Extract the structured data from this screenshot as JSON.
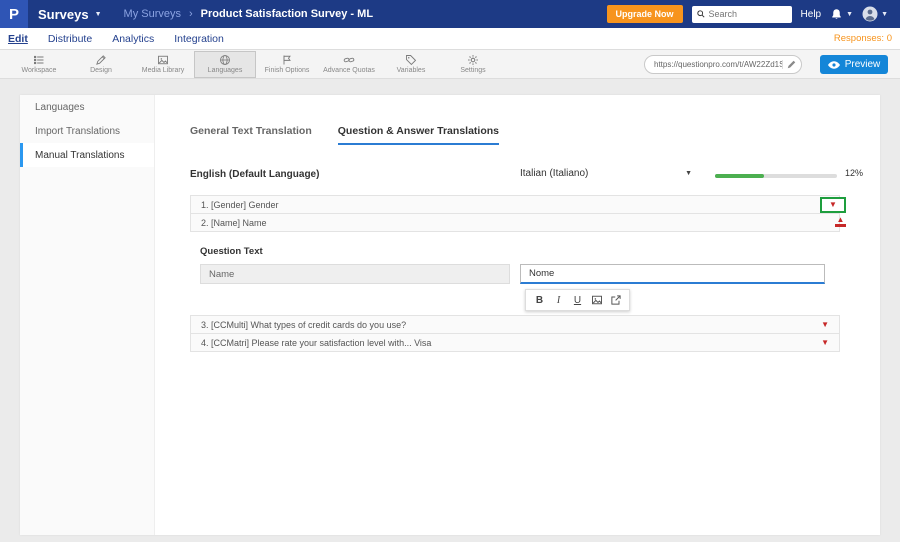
{
  "topbar": {
    "logo_letter": "P",
    "app_menu": "Surveys",
    "breadcrumb": "My Surveys",
    "separator": "›",
    "page_title": "Product Satisfaction Survey - ML",
    "upgrade_label": "Upgrade Now",
    "search_placeholder": "Search",
    "help_label": "Help"
  },
  "navbar": {
    "items": [
      {
        "label": "Edit"
      },
      {
        "label": "Distribute"
      },
      {
        "label": "Analytics"
      },
      {
        "label": "Integration"
      }
    ],
    "responses_label": "Responses: 0"
  },
  "toolbar": {
    "items": [
      {
        "label": "Workspace"
      },
      {
        "label": "Design"
      },
      {
        "label": "Media Library"
      },
      {
        "label": "Languages"
      },
      {
        "label": "Finish Options"
      },
      {
        "label": "Advance Quotas"
      },
      {
        "label": "Variables"
      },
      {
        "label": "Settings"
      }
    ],
    "survey_url": "https://questionpro.com/t/AW22Zd1S1",
    "preview_label": "Preview"
  },
  "sidebar": {
    "items": [
      {
        "label": "Languages"
      },
      {
        "label": "Import Translations"
      },
      {
        "label": "Manual Translations"
      }
    ]
  },
  "translation": {
    "tabs": [
      {
        "label": "General Text Translation"
      },
      {
        "label": "Question & Answer Translations"
      }
    ],
    "source_language": "English (Default Language)",
    "target_language": "Italian (Italiano)",
    "progress_label": "12%",
    "questions": [
      {
        "label": "1. [Gender] Gender"
      },
      {
        "label": "2. [Name] Name"
      },
      {
        "label": "3. [CCMulti] What types of credit cards do you use?"
      },
      {
        "label": "4. [CCMatri] Please rate your satisfaction level with... Visa"
      }
    ],
    "editor": {
      "section_label": "Question Text",
      "source_value": "Name",
      "target_value": "Nome",
      "format_bold": "B",
      "format_italic": "I",
      "format_underline": "U"
    }
  },
  "colors": {
    "topbar_navy": "#1d3a85",
    "accent_orange": "#f7941d",
    "preview_blue": "#1486d8",
    "tab_blue": "#2b7cd3",
    "progress_green": "#4caf50",
    "caret_red": "#c62828",
    "highlight_green": "#1e9e3e"
  }
}
